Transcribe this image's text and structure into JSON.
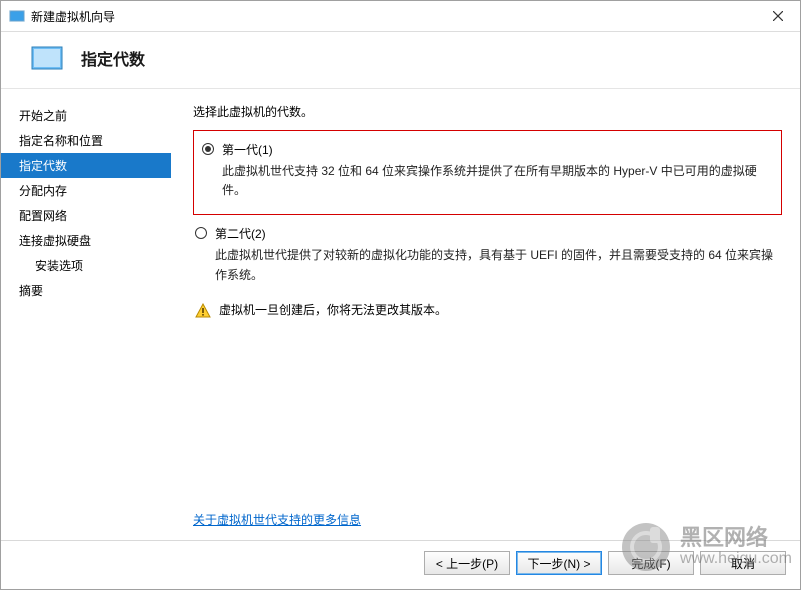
{
  "window": {
    "title": "新建虚拟机向导"
  },
  "header": {
    "title": "指定代数"
  },
  "sidebar": {
    "items": [
      {
        "label": "开始之前",
        "indent": false
      },
      {
        "label": "指定名称和位置",
        "indent": false
      },
      {
        "label": "指定代数",
        "indent": false,
        "selected": true
      },
      {
        "label": "分配内存",
        "indent": false
      },
      {
        "label": "配置网络",
        "indent": false
      },
      {
        "label": "连接虚拟硬盘",
        "indent": false
      },
      {
        "label": "安装选项",
        "indent": true
      },
      {
        "label": "摘要",
        "indent": false
      }
    ]
  },
  "main": {
    "prompt": "选择此虚拟机的代数。",
    "gen1": {
      "label": "第一代(1)",
      "desc": "此虚拟机世代支持 32 位和 64 位来宾操作系统并提供了在所有早期版本的 Hyper-V 中已可用的虚拟硬件。"
    },
    "gen2": {
      "label": "第二代(2)",
      "desc": "此虚拟机世代提供了对较新的虚拟化功能的支持，具有基于 UEFI 的固件，并且需要受支持的 64 位来宾操作系统。"
    },
    "warning": "虚拟机一旦创建后，你将无法更改其版本。",
    "link": "关于虚拟机世代支持的更多信息"
  },
  "buttons": {
    "prev": "< 上一步(P)",
    "next": "下一步(N) >",
    "finish": "完成(F)",
    "cancel": "取消"
  },
  "watermark": {
    "line1": "黑区网络",
    "line2": "www.heiqu.com"
  }
}
